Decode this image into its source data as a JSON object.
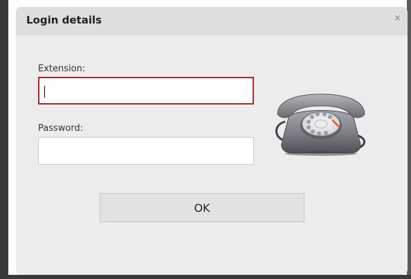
{
  "dialog": {
    "title": "Login details",
    "close_glyph": "×"
  },
  "form": {
    "extension_label": "Extension:",
    "extension_value": "",
    "password_label": "Password:",
    "password_value": "",
    "ok_label": "OK"
  },
  "icons": {
    "close": "close-icon",
    "phone": "rotary-phone-icon"
  },
  "colors": {
    "active_border": "#a02a2a",
    "dialog_bg": "#ececec",
    "titlebar_bg": "#dedede",
    "button_bg": "#e2e2e2"
  }
}
